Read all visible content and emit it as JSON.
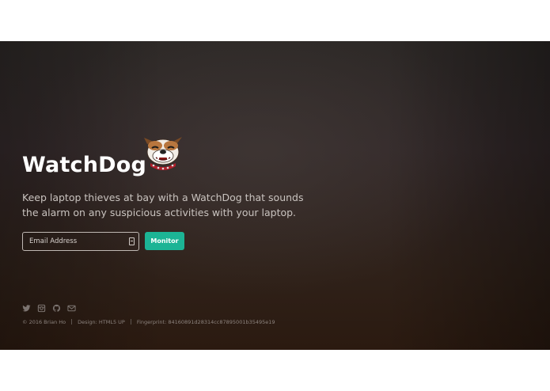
{
  "hero": {
    "title": "WatchDog",
    "tagline": "Keep laptop thieves at bay with a WatchDog that sounds the alarm on any suspicious activities with your laptop.",
    "mascot_icon": "bulldog-mascot-icon"
  },
  "form": {
    "email_placeholder": "Email Address",
    "email_value": "",
    "monitor_label": "Monitor"
  },
  "socials": [
    {
      "icon": "twitter-icon"
    },
    {
      "icon": "instagram-icon"
    },
    {
      "icon": "github-icon"
    },
    {
      "icon": "email-icon"
    }
  ],
  "footer": {
    "copyright": "© 2016 Brian Ho",
    "design": "Design: HTML5 UP",
    "fingerprint": "Fingerprint: 84160891d28314cc87895001b35495e19"
  },
  "colors": {
    "accent": "#1cb495",
    "background_top": "#2c2826",
    "background_bottom": "#2b1a10",
    "title_text": "#ffffff"
  }
}
